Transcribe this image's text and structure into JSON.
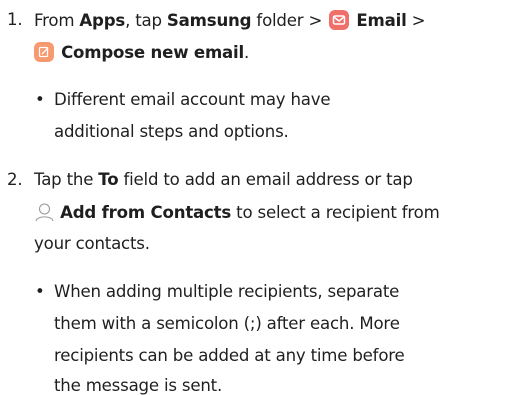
{
  "step1": {
    "number": "1.",
    "from": "From",
    "apps": "Apps",
    "tap": ", tap",
    "samsung": "Samsung",
    "folder": "folder",
    "sep1": ">",
    "email": "Email",
    "sep2": ">",
    "compose": "Compose new email",
    "period": ".",
    "note_bullet": "•",
    "note_line1": "Different email account may have",
    "note_line2": "additional steps and options."
  },
  "step2": {
    "number": "2.",
    "tap_the": "Tap the",
    "to": "To",
    "line1_rest": "field to add an email address or tap",
    "add_from_contacts": "Add from Contacts",
    "line2_rest": "to select a recipient from",
    "line3": "your contacts.",
    "note_bullet": "•",
    "note_line1": "When adding multiple recipients, separate",
    "note_line2": "them with a semicolon (;) after each. More",
    "note_line3": "recipients can be added at any time before",
    "note_line4": "the message is sent."
  },
  "icons": {
    "email": "email-app-icon",
    "compose": "compose-icon",
    "contacts": "contacts-icon"
  },
  "colors": {
    "email_icon": "#ef6f6a",
    "compose_icon": "#f79a6f",
    "text": "#1f1f1f"
  }
}
